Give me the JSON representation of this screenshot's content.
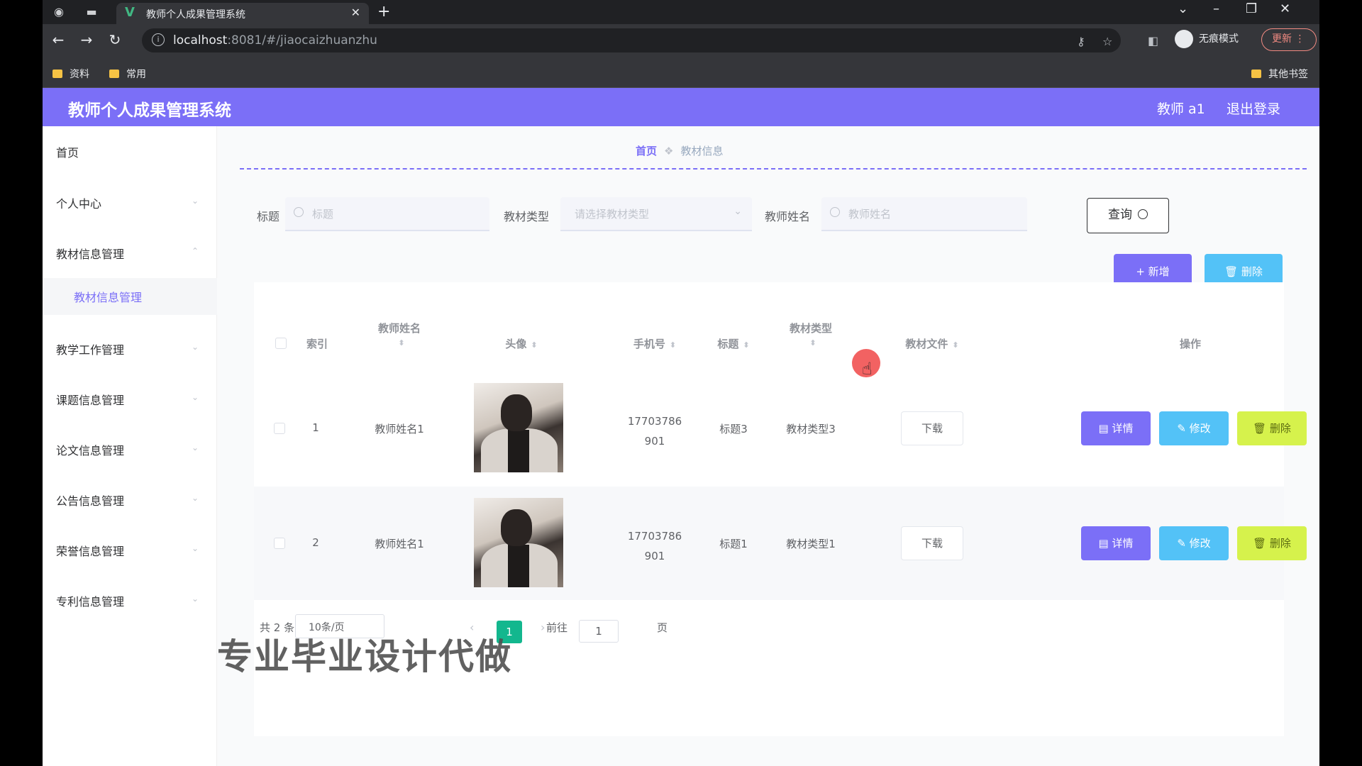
{
  "browser": {
    "tab_title": "教师个人成果管理系统",
    "url_host": "localhost",
    "url_rest": ":8081/#/jiaocaizhuanzhu",
    "incognito_label": "无痕模式",
    "update_label": "更新",
    "bookmarks": [
      "资料",
      "常用"
    ],
    "other_bookmarks": "其他书签"
  },
  "header": {
    "brand": "教师个人成果管理系统",
    "user": "教师 a1",
    "logout": "退出登录",
    "accent": "#7b6ff7"
  },
  "sidebar": {
    "items": [
      {
        "label": "首页"
      },
      {
        "label": "个人中心"
      },
      {
        "label": "教材信息管理"
      },
      {
        "label": "教学工作管理"
      },
      {
        "label": "课题信息管理"
      },
      {
        "label": "论文信息管理"
      },
      {
        "label": "公告信息管理"
      },
      {
        "label": "荣誉信息管理"
      },
      {
        "label": "专利信息管理"
      }
    ],
    "active_sub": "教材信息管理"
  },
  "breadcrumb": {
    "home": "首页",
    "current": "教材信息"
  },
  "search": {
    "title_label": "标题",
    "title_placeholder": "标题",
    "type_label": "教材类型",
    "type_placeholder": "请选择教材类型",
    "teacher_label": "教师姓名",
    "teacher_placeholder": "教师姓名",
    "query_label": "查询"
  },
  "actions": {
    "add": "+ 新增",
    "delete": "删除"
  },
  "table": {
    "headers": {
      "index": "索引",
      "teacher": "教师姓名",
      "avatar": "头像",
      "phone": "手机号",
      "title": "标题",
      "type": "教材类型",
      "file": "教材文件",
      "ops": "操作"
    },
    "rows": [
      {
        "index": "1",
        "teacher": "教师姓名1",
        "phone_a": "17703786",
        "phone_b": "901",
        "title": "标题3",
        "type": "教材类型3",
        "file": "下载"
      },
      {
        "index": "2",
        "teacher": "教师姓名1",
        "phone_a": "17703786",
        "phone_b": "901",
        "title": "标题1",
        "type": "教材类型1",
        "file": "下载"
      }
    ],
    "ops": {
      "detail": "详情",
      "edit": "修改",
      "delete": "删除"
    }
  },
  "pagination": {
    "total": "共 2 条",
    "page_size": "10条/页",
    "current": "1",
    "goto_label": "前往",
    "goto_value": "1",
    "page_unit": "页"
  },
  "watermark": "专业毕业设计代做"
}
